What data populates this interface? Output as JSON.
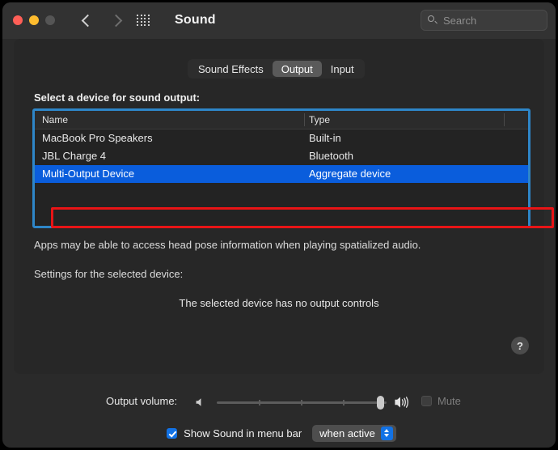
{
  "window": {
    "title": "Sound",
    "traffic_lights": [
      "close",
      "minimize",
      "zoom"
    ],
    "nav": {
      "back_icon": "chevron-left-icon",
      "forward_icon": "chevron-right-icon",
      "grid_icon": "grid-dots-icon"
    }
  },
  "search": {
    "placeholder": "Search",
    "value": "",
    "icon": "search-icon"
  },
  "tabs": [
    {
      "label": "Sound Effects",
      "active": false
    },
    {
      "label": "Output",
      "active": true
    },
    {
      "label": "Input",
      "active": false
    }
  ],
  "main": {
    "section_label": "Select a device for sound output:",
    "table": {
      "columns": [
        "Name",
        "Type"
      ],
      "rows": [
        {
          "name": "MacBook Pro Speakers",
          "type": "Built-in",
          "selected": false
        },
        {
          "name": "JBL Charge 4",
          "type": "Bluetooth",
          "selected": false
        },
        {
          "name": "Multi-Output Device",
          "type": "Aggregate device",
          "selected": true
        }
      ]
    },
    "spatial_note": "Apps may be able to access head pose information when playing spatialized audio.",
    "settings_label": "Settings for the selected device:",
    "no_controls_message": "The selected device has no output controls",
    "help_label": "?"
  },
  "footer": {
    "volume_label": "Output volume:",
    "volume_percent": 96,
    "speaker_low_icon": "speaker-low-icon",
    "speaker_high_icon": "speaker-high-icon",
    "mute_label": "Mute",
    "mute_checked": false,
    "mute_enabled": false,
    "menubar_label": "Show Sound in menu bar",
    "menubar_checked": true,
    "menubar_option": "when active"
  },
  "annotations": {
    "table_highlight_color": "#2e86c8",
    "selected_row_highlight_color": "#e81416",
    "selection_blue": "#0a5ddc"
  }
}
